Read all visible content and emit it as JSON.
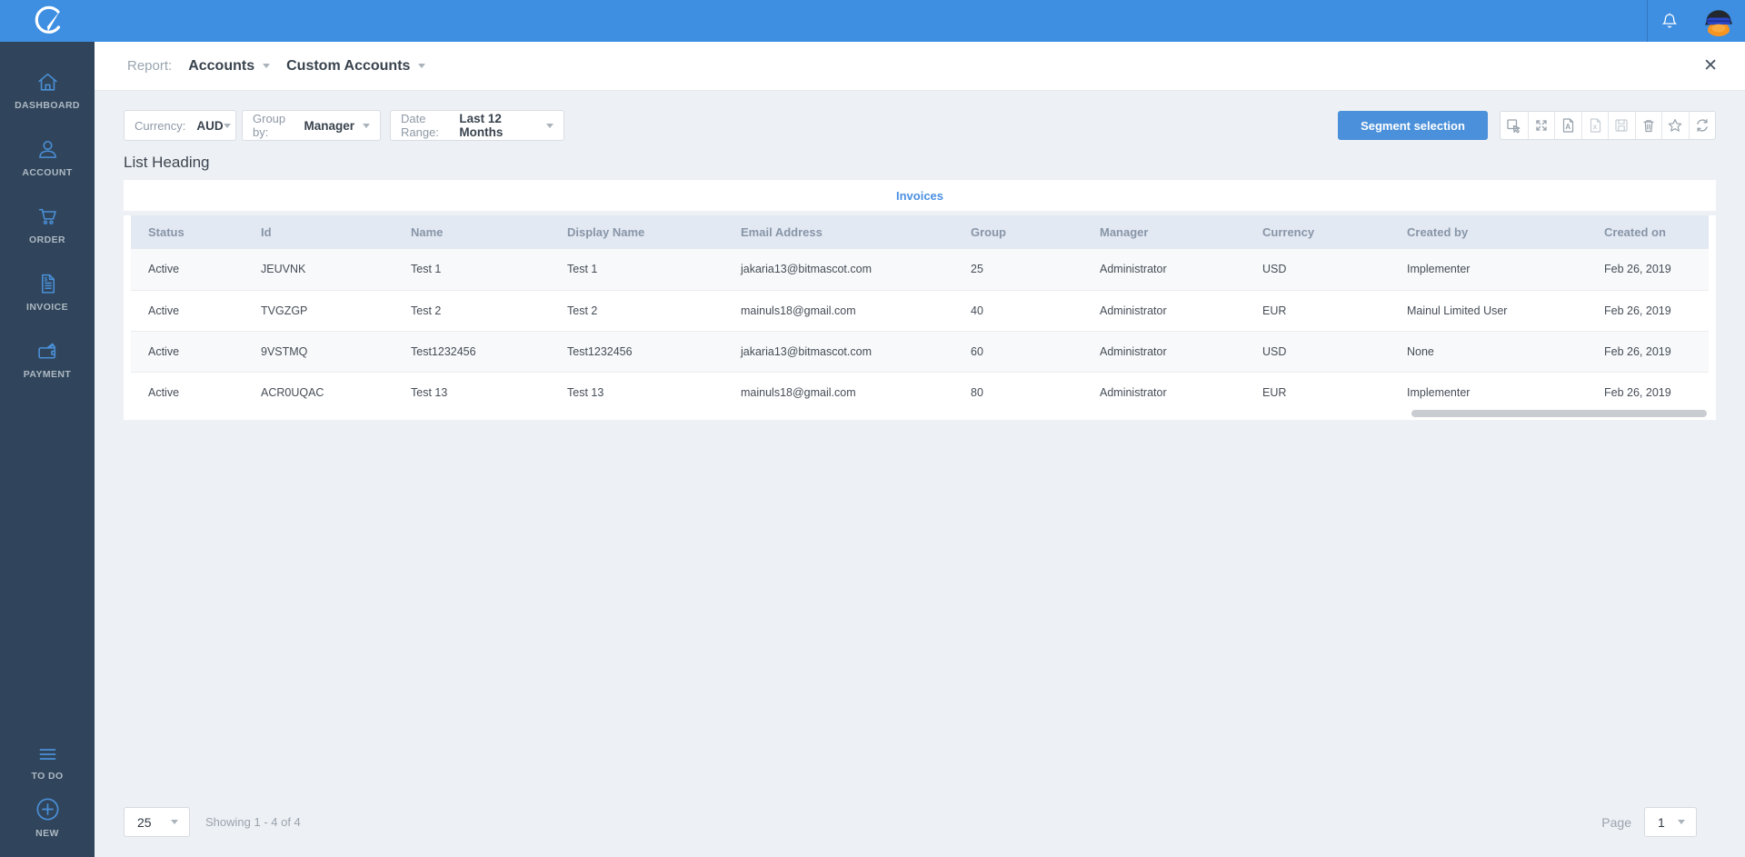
{
  "topbar": {
    "logo": "brand-mark",
    "notification": "bell",
    "avatar": "penguin-profile-photo"
  },
  "sidebar": {
    "items": [
      {
        "label": "DASHBOARD",
        "icon": "home-icon"
      },
      {
        "label": "ACCOUNT",
        "icon": "user-icon"
      },
      {
        "label": "ORDER",
        "icon": "cart-icon"
      },
      {
        "label": "INVOICE",
        "icon": "invoice-icon"
      },
      {
        "label": "PAYMENT",
        "icon": "wallet-icon"
      }
    ],
    "footer_items": [
      {
        "label": "TO DO",
        "icon": "list-icon"
      },
      {
        "label": "NEW",
        "icon": "plus-circle-icon"
      }
    ],
    "accent_color": "#4a90d9",
    "background_color": "#30455b"
  },
  "header": {
    "report_label": "Report:",
    "report_type": "Accounts",
    "report_name": "Custom Accounts",
    "close_glyph": "✕"
  },
  "filters": {
    "currency_label": "Currency:",
    "currency_value": "AUD",
    "groupby_label": "Group by:",
    "groupby_value": "Manager",
    "daterange_label": "Date Range:",
    "daterange_value": "Last 12 Months"
  },
  "toolbar": {
    "segment_button": "Segment selection",
    "icons": [
      "select-cursor-icon",
      "expand-icon",
      "export-pdf-icon",
      "export-excel-icon",
      "save-icon",
      "delete-icon",
      "favorite-star-icon",
      "refresh-icon"
    ],
    "button_color": "#4a90da"
  },
  "list": {
    "heading": "List Heading",
    "tab": "Invoices",
    "columns": [
      "Status",
      "Id",
      "Name",
      "Display Name",
      "Email Address",
      "Group",
      "Manager",
      "Currency",
      "Created by",
      "Created on"
    ],
    "rows": [
      [
        "Active",
        "JEUVNK",
        "Test 1",
        "Test 1",
        "jakaria13@bitmascot.com",
        "25",
        "Administrator",
        "USD",
        "Implementer",
        "Feb 26, 2019"
      ],
      [
        "Active",
        "TVGZGP",
        "Test 2",
        "Test 2",
        "mainuls18@gmail.com",
        "40",
        "Administrator",
        "EUR",
        "Mainul Limited User",
        "Feb 26, 2019"
      ],
      [
        "Active",
        "9VSTMQ",
        "Test1232456",
        "Test1232456",
        "jakaria13@bitmascot.com",
        "60",
        "Administrator",
        "USD",
        "None",
        "Feb 26, 2019"
      ],
      [
        "Active",
        "ACR0UQAC",
        "Test 13",
        "Test 13",
        "mainuls18@gmail.com",
        "80",
        "Administrator",
        "EUR",
        "Implementer",
        "Feb 26, 2019"
      ]
    ]
  },
  "pagination": {
    "page_size": "25",
    "showing": "Showing 1 - 4 of 4",
    "page_label": "Page",
    "page_number": "1"
  }
}
